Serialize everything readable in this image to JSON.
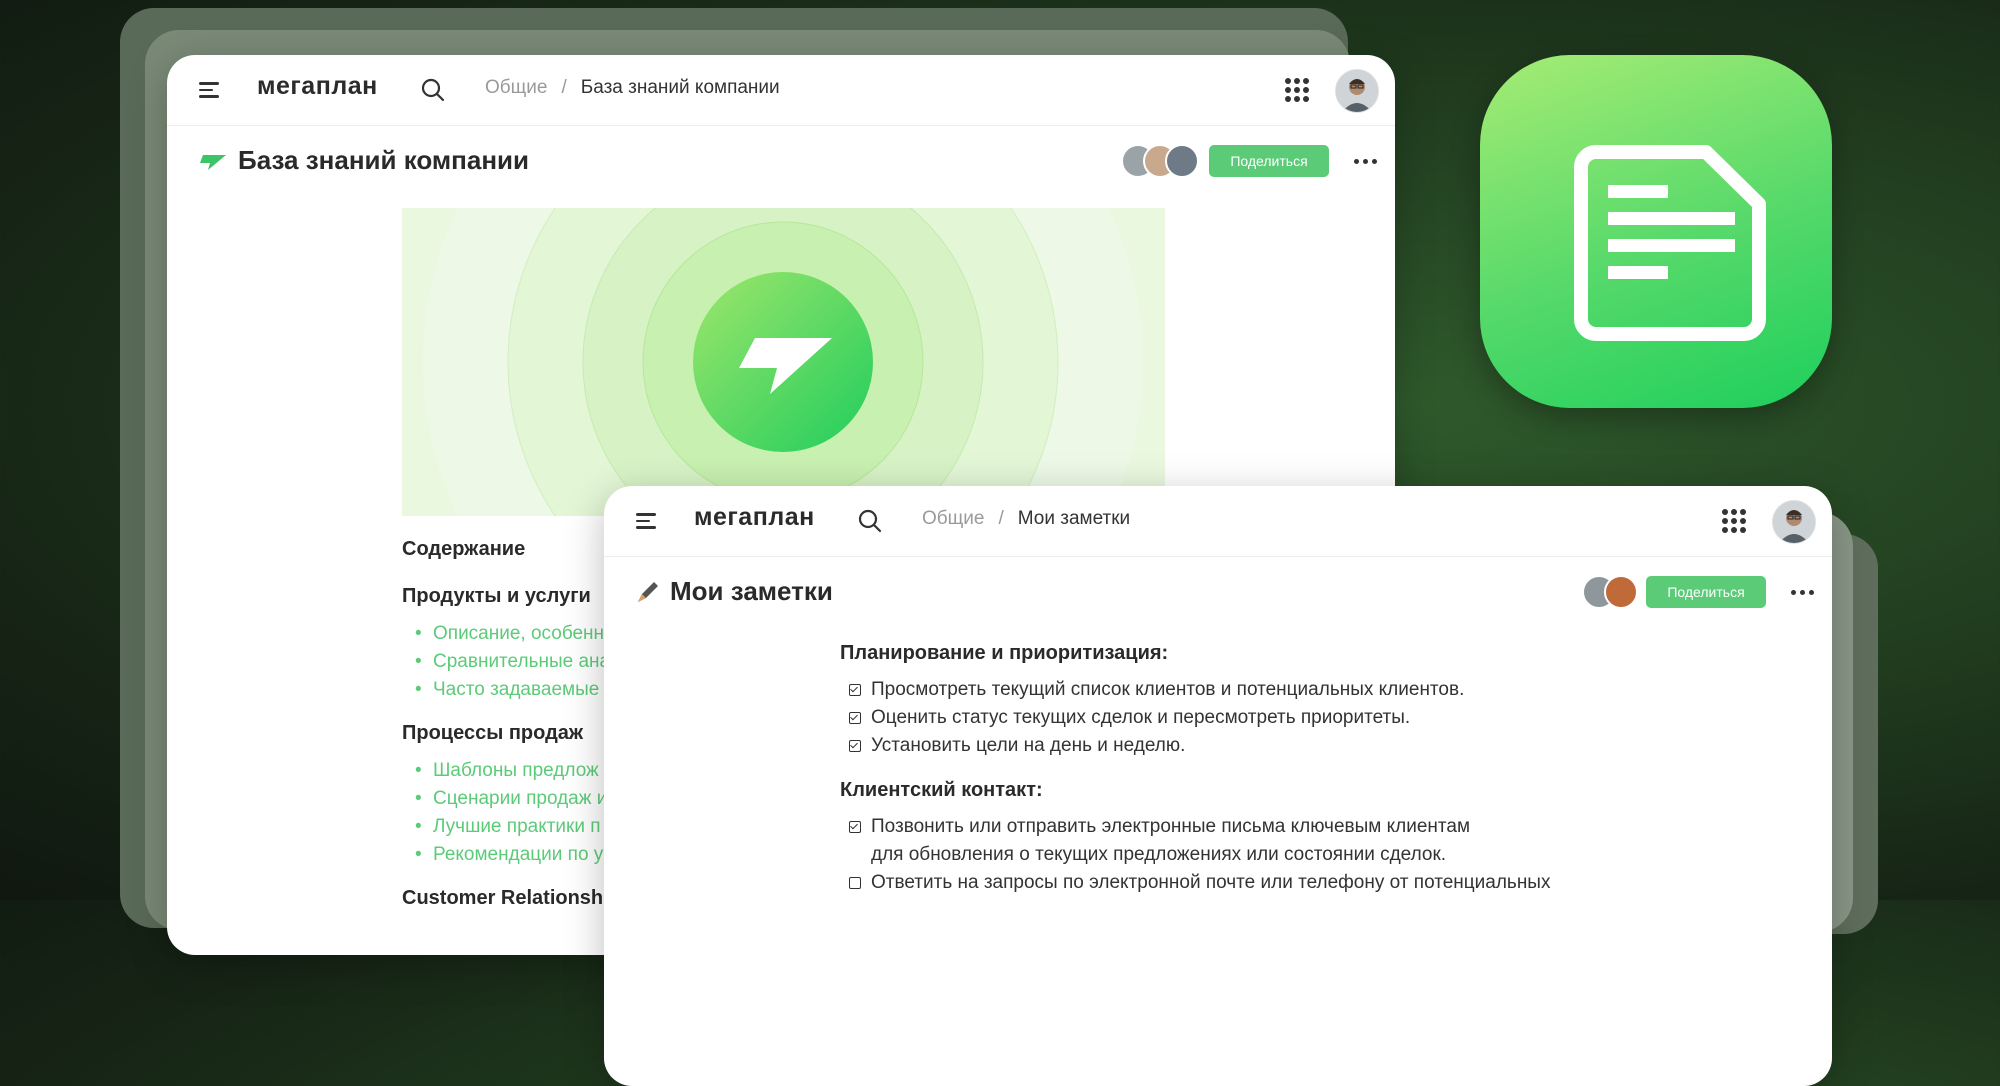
{
  "kb_window": {
    "logo": "мегаплан",
    "breadcrumb": {
      "root": "Общие",
      "separator": "/",
      "current": "База знаний компании"
    },
    "page_title": "База знаний компании",
    "share_label": "Поделиться",
    "toc_heading": "Содержание",
    "sections": [
      {
        "title": "Продукты и услуги",
        "items": [
          "Описание, особенн",
          "Сравнительные ана",
          "Часто задаваемые"
        ]
      },
      {
        "title": "Процессы продаж",
        "items": [
          "Шаблоны предлож",
          "Сценарии продаж и",
          "Лучшие практики п",
          "Рекомендации по у"
        ]
      },
      {
        "title": "Customer Relationshi",
        "items": []
      }
    ]
  },
  "notes_window": {
    "logo": "мегаплан",
    "breadcrumb": {
      "root": "Общие",
      "separator": "/",
      "current": "Мои заметки"
    },
    "page_title": "Мои заметки",
    "share_label": "Поделиться",
    "sections": [
      {
        "title": "Планирование и приоритизация:",
        "items": [
          {
            "text": "Просмотреть текущий список клиентов и потенциальных клиентов.",
            "checked": true
          },
          {
            "text": "Оценить статус текущих сделок и пересмотреть приоритеты.",
            "checked": true
          },
          {
            "text": "Установить цели на день и неделю.",
            "checked": true
          }
        ]
      },
      {
        "title": "Клиентский контакт:",
        "items": [
          {
            "text": "Позвонить или отправить электронные письма ключевым клиентам",
            "text2": "для обновления о текущих предложениях или состоянии сделок.",
            "checked": true
          },
          {
            "text": "Ответить на запросы по электронной почте или телефону от потенциальных",
            "checked": false
          }
        ]
      }
    ]
  },
  "colors": {
    "accent": "#5ccb78",
    "background": "#1c2e1a"
  },
  "icons": [
    "menu-icon",
    "search-icon",
    "apps-grid-icon",
    "more-icon",
    "document-app-icon",
    "paper-plane-icon",
    "pen-icon"
  ]
}
